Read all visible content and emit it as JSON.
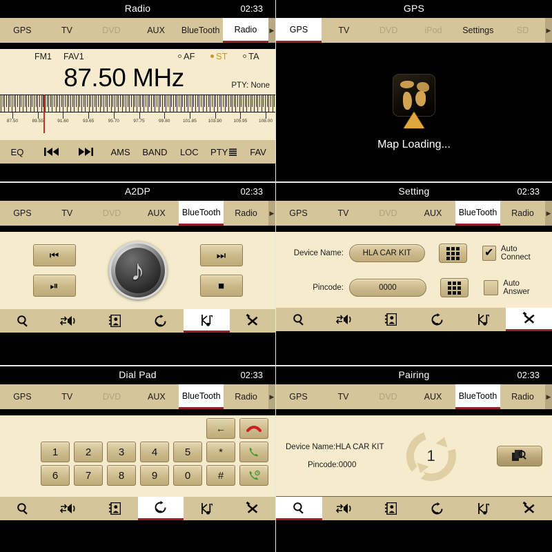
{
  "clock": "02:33",
  "tab_arrow_icon": "chevron-right-icon",
  "panels": {
    "radio": {
      "title": "Radio",
      "clock": "02:33",
      "tabs": [
        {
          "label": "GPS",
          "state": "normal"
        },
        {
          "label": "TV",
          "state": "normal"
        },
        {
          "label": "DVD",
          "state": "disabled"
        },
        {
          "label": "AUX",
          "state": "normal"
        },
        {
          "label": "BlueTooth",
          "state": "normal"
        },
        {
          "label": "Radio",
          "state": "active"
        }
      ],
      "band": "FM1",
      "preset": "FAV1",
      "indicators": [
        {
          "label": "AF",
          "on": false
        },
        {
          "label": "ST",
          "on": true
        },
        {
          "label": "TA",
          "on": false
        }
      ],
      "frequency": "87.50 MHz",
      "pty": "PTY:  None",
      "scale_labels": [
        "87.50",
        "89.55",
        "91.60",
        "93.65",
        "95.70",
        "97.75",
        "99.80",
        "101.85",
        "103.90",
        "105.95",
        "108.00"
      ],
      "needle_position_pct": 12.2,
      "buttons": [
        {
          "label": "EQ",
          "icon": ""
        },
        {
          "label": "",
          "icon": "prev-track-icon"
        },
        {
          "label": "",
          "icon": "next-track-icon"
        },
        {
          "label": "AMS",
          "icon": ""
        },
        {
          "label": "BAND",
          "icon": ""
        },
        {
          "label": "LOC",
          "icon": ""
        },
        {
          "label": "PTY",
          "icon": "list-icon"
        },
        {
          "label": "FAV",
          "icon": ""
        }
      ]
    },
    "gps": {
      "title": "GPS",
      "clock": "",
      "tabs": [
        {
          "label": "GPS",
          "state": "active"
        },
        {
          "label": "TV",
          "state": "normal"
        },
        {
          "label": "DVD",
          "state": "disabled"
        },
        {
          "label": "iPod",
          "state": "disabled"
        },
        {
          "label": "Settings",
          "state": "normal"
        },
        {
          "label": "SD",
          "state": "disabled"
        }
      ],
      "status": "Map Loading...",
      "icon": "globe-navigation-icon"
    },
    "a2dp": {
      "title": "A2DP",
      "clock": "02:33",
      "tabs": [
        {
          "label": "GPS",
          "state": "normal"
        },
        {
          "label": "TV",
          "state": "normal"
        },
        {
          "label": "DVD",
          "state": "disabled"
        },
        {
          "label": "AUX",
          "state": "normal"
        },
        {
          "label": "BlueTooth",
          "state": "active"
        },
        {
          "label": "Radio",
          "state": "normal"
        }
      ],
      "media_buttons": {
        "prev": "⏮",
        "next": "⏭",
        "play_pause": "⏯",
        "stop": "■"
      },
      "album_icon": "music-note-disc-icon",
      "album_note": "♪"
    },
    "setting": {
      "title": "Setting",
      "clock": "02:33",
      "tabs": [
        {
          "label": "GPS",
          "state": "normal"
        },
        {
          "label": "TV",
          "state": "normal"
        },
        {
          "label": "DVD",
          "state": "disabled"
        },
        {
          "label": "AUX",
          "state": "normal"
        },
        {
          "label": "BlueTooth",
          "state": "active"
        },
        {
          "label": "Radio",
          "state": "normal"
        }
      ],
      "rows": [
        {
          "label": "Device Name:",
          "value": "HLA CAR KIT",
          "keypad_icon": "keypad-icon",
          "checkbox_label": "Auto Connect",
          "checked": true,
          "check_glyph": "✔"
        },
        {
          "label": "Pincode:",
          "value": "0000",
          "keypad_icon": "keypad-icon",
          "checkbox_label": "Auto Answer",
          "checked": false,
          "check_glyph": ""
        }
      ]
    },
    "dialpad": {
      "title": "Dial Pad",
      "clock": "02:33",
      "tabs": [
        {
          "label": "GPS",
          "state": "normal"
        },
        {
          "label": "TV",
          "state": "normal"
        },
        {
          "label": "DVD",
          "state": "disabled"
        },
        {
          "label": "AUX",
          "state": "normal"
        },
        {
          "label": "BlueTooth",
          "state": "active"
        },
        {
          "label": "Radio",
          "state": "normal"
        }
      ],
      "top_row": [
        {
          "label": "←",
          "name": "backspace-key",
          "kind": "small"
        },
        {
          "label": "",
          "name": "hangup-key",
          "kind": "hang"
        }
      ],
      "row1": [
        "1",
        "2",
        "3",
        "4",
        "5",
        "*"
      ],
      "row1_action": {
        "label": "",
        "name": "call-key"
      },
      "row2": [
        "6",
        "7",
        "8",
        "9",
        "0",
        "#"
      ],
      "row2_action": {
        "label": "",
        "name": "redial-key"
      }
    },
    "pairing": {
      "title": "Pairing",
      "clock": "02:33",
      "tabs": [
        {
          "label": "GPS",
          "state": "normal"
        },
        {
          "label": "TV",
          "state": "normal"
        },
        {
          "label": "DVD",
          "state": "disabled"
        },
        {
          "label": "AUX",
          "state": "normal"
        },
        {
          "label": "BlueTooth",
          "state": "active"
        },
        {
          "label": "Radio",
          "state": "normal"
        }
      ],
      "device_name_line": "Device Name:HLA CAR KIT",
      "pincode_line": "Pincode:0000",
      "spinner_count": "1",
      "search_button_icon": "search-device-icon"
    }
  },
  "iconbar": {
    "items": [
      {
        "name": "search-icon",
        "label": "Search"
      },
      {
        "name": "audio-transfer-icon",
        "label": "Audio Transfer"
      },
      {
        "name": "phonebook-icon",
        "label": "Phonebook"
      },
      {
        "name": "call-history-icon",
        "label": "Call History"
      },
      {
        "name": "bluetooth-music-icon",
        "label": "Bluetooth Music"
      },
      {
        "name": "tools-icon",
        "label": "Settings Tools"
      }
    ],
    "active_index": {
      "a2dp": 4,
      "setting": 5,
      "dialpad": 3,
      "pairing": 0
    }
  },
  "colors": {
    "tabbar_bg": "#d6c49a",
    "content_cream": "#f6eccd",
    "active_underline": "#97202a",
    "needle": "#c0332b",
    "indicator_on": "#c8962a",
    "gps_globe": "#e8b45c"
  }
}
